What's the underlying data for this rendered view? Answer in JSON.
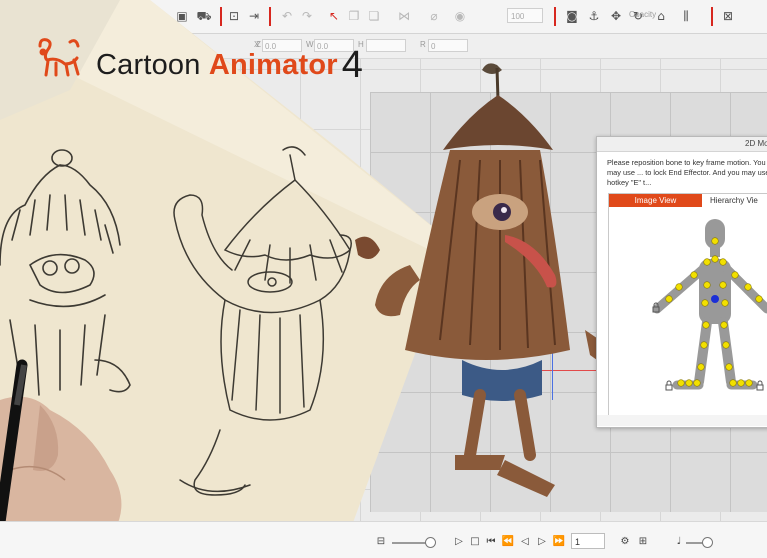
{
  "app": {
    "logo_word1": "Cartoon",
    "logo_word2": "Animator",
    "logo_version": "4",
    "accent_color": "#e0491a"
  },
  "toolbar": {
    "opacity_label": "Opacity",
    "opacity_value": "100",
    "icons": [
      "save-icon",
      "cart-icon",
      "import-icon",
      "export-icon",
      "undo-icon",
      "redo-icon",
      "select-icon",
      "copy-icon",
      "paste-icon",
      "transform-icon",
      "pin-icon",
      "visibility-icon",
      "camera-icon",
      "puppet-icon",
      "move-icon",
      "rotate-icon",
      "home-icon",
      "align-icon",
      "render-icon"
    ]
  },
  "properties": {
    "fields": [
      {
        "label": "X",
        "value": ""
      },
      {
        "label": "Z",
        "value": "0.0"
      },
      {
        "label": "W",
        "value": "0.0"
      },
      {
        "label": "H",
        "value": ""
      },
      {
        "label": "R",
        "value": "0"
      }
    ]
  },
  "dialog": {
    "title": "2D Mo",
    "instruction": "Please reposition bone to key frame motion. You may use ... to lock End Effector. And you may use hotkey \"E\" t...",
    "tabs": {
      "image_view": "Image View",
      "hierarchy_view": "Hierarchy Vie"
    }
  },
  "timeline": {
    "current_frame": "1",
    "icons": [
      "zoom-icon",
      "play-icon",
      "stop-icon",
      "first-frame-icon",
      "prev-key-icon",
      "prev-frame-icon",
      "next-frame-icon",
      "next-key-icon",
      "last-frame-icon",
      "loop-icon",
      "settings-icon",
      "audio-icon"
    ]
  }
}
